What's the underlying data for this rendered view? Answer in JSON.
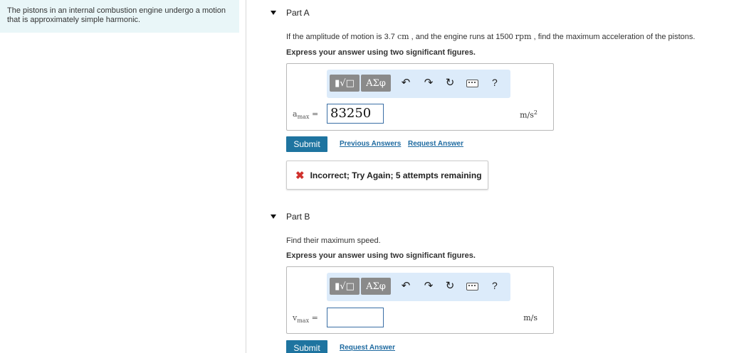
{
  "intro": {
    "text": "The pistons in an internal combustion engine undergo a motion that is approximately simple harmonic."
  },
  "part_a": {
    "title": "Part A",
    "question_pre": "If the amplitude of motion is 3.7",
    "unit_cm": "cm",
    "question_mid": ", and the engine runs at 1500",
    "unit_rpm": "rpm",
    "question_post": ", find the maximum acceleration of the pistons.",
    "instruction": "Express your answer using two significant figures.",
    "var_main": "a",
    "var_sub": "max",
    "equals": "=",
    "answer_value": "83250",
    "unit": "m/s",
    "unit_exp": "2",
    "submit_label": "Submit",
    "previous_answers_label": "Previous Answers",
    "request_answer_label": "Request Answer",
    "feedback_text": "Incorrect; Try Again; 5 attempts remaining"
  },
  "part_b": {
    "title": "Part B",
    "question": "Find their maximum speed.",
    "instruction": "Express your answer using two significant figures.",
    "var_main": "v",
    "var_sub": "max",
    "equals": "=",
    "answer_value": "",
    "unit": "m/s",
    "submit_label": "Submit",
    "request_answer_label": "Request Answer"
  },
  "toolbar": {
    "templates_icon": "template-icon",
    "greek_label": "ΑΣφ",
    "undo_icon": "↶",
    "redo_icon": "↷",
    "reset_icon": "↻",
    "help_label": "?"
  }
}
